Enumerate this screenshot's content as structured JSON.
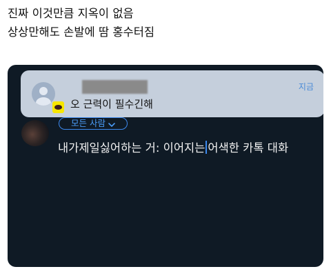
{
  "caption": {
    "line1": "진짜 이것만큼 지옥이 없음",
    "line2": "상상만해도 손발에 땀 홍수터짐"
  },
  "notification": {
    "time": "지금",
    "message": "오 근력이 필수긴해",
    "app_icon": "kakaotalk-icon",
    "accent_color": "#f7e600"
  },
  "composer": {
    "audience_label": "모든 사람",
    "text_before_cursor": "내가제일싫어하는 거: 이어지는",
    "text_after_cursor": "어색한 카톡 대화"
  },
  "colors": {
    "screen_bg": "#0f1a25",
    "notification_bg": "#c5cfdc",
    "accent_blue": "#3d8af0"
  }
}
